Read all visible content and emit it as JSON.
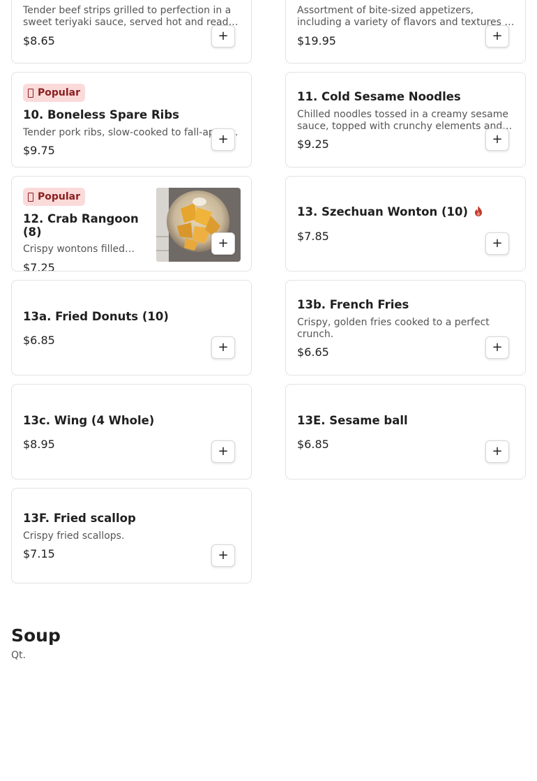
{
  "add_label": "+",
  "popular_label": "Popular",
  "items": [
    {
      "title": "",
      "desc": "Tender beef strips grilled to perfection in a sweet teriyaki sauce, served hot and ready to enjoy.",
      "price": "$8.65"
    },
    {
      "title": "",
      "desc": "Assortment of bite-sized appetizers, including a variety of flavors and textures to share.",
      "price": "$19.95"
    },
    {
      "title": "10. Boneless Spare Ribs",
      "desc": "Tender pork ribs, slow-cooked to fall-apart perfection.",
      "price": "$9.75",
      "popular": true
    },
    {
      "title": "11. Cold Sesame Noodles",
      "desc": "Chilled noodles tossed in a creamy sesame sauce, topped with crunchy elements and fresh garnish.",
      "price": "$9.25"
    },
    {
      "title": "12. Crab Rangoon (8)",
      "desc": "Crispy wontons filled with creamy crab.",
      "price": "$7.25",
      "popular": true
    },
    {
      "title": "13. Szechuan Wonton (10)",
      "desc": "",
      "price": "$7.85",
      "spicy": true
    },
    {
      "title": "13a. Fried Donuts (10)",
      "desc": "",
      "price": "$6.85"
    },
    {
      "title": "13b. French Fries",
      "desc": "Crispy, golden fries cooked to a perfect crunch.",
      "price": "$6.65"
    },
    {
      "title": "13c. Wing (4 Whole)",
      "desc": "",
      "price": "$8.95"
    },
    {
      "title": "13E. Sesame ball",
      "desc": "",
      "price": "$6.85"
    },
    {
      "title": "13F. Fried scallop",
      "desc": "Crispy fried scallops.",
      "price": "$7.15"
    }
  ],
  "section": {
    "title": "Soup",
    "subtitle": "Qt."
  },
  "colors": {
    "popular_bg": "#fbdada",
    "popular_text": "#8a1f1f",
    "spicy": "#c0392b"
  }
}
